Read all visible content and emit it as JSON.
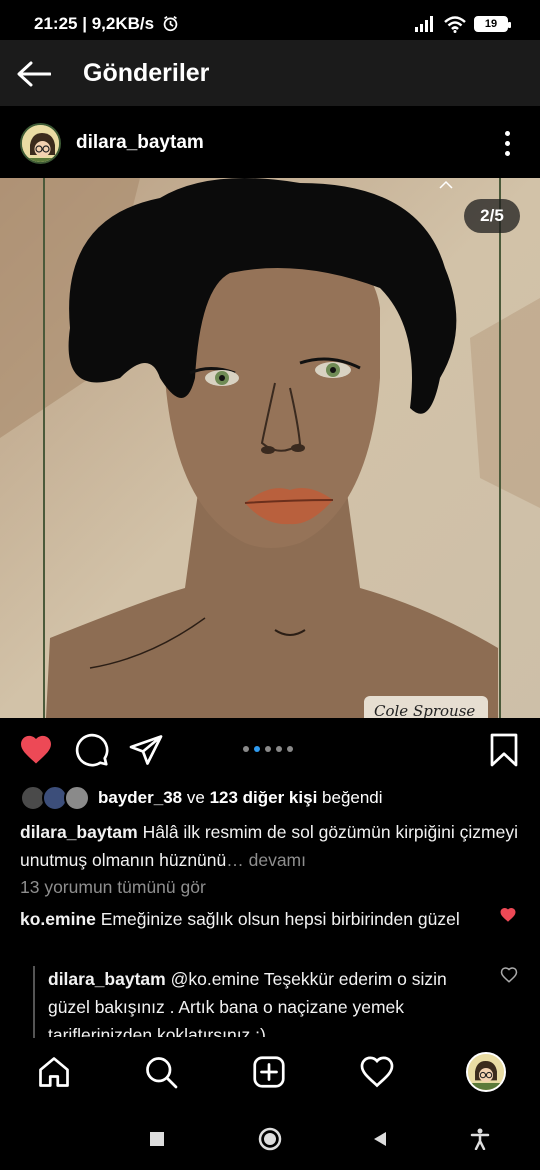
{
  "status": {
    "time": "21:25",
    "speed": "9,2KB/s",
    "battery": "19",
    "icons": [
      "alarm-icon",
      "signal-icon",
      "wifi-icon",
      "battery-icon"
    ]
  },
  "header": {
    "title": "Gönderiler",
    "back_icon": "arrow-left-icon"
  },
  "post": {
    "username": "dilara_baytam",
    "media_counter": "2/5",
    "signature": "Cole Sprouse",
    "carousel_dots": 5,
    "active_dot": 2,
    "liked": true
  },
  "likes": {
    "first_liker": "bayder_38",
    "connector": "ve",
    "others": "123 diğer kişi",
    "suffix": "beğendi"
  },
  "caption": {
    "username": "dilara_baytam",
    "text": "Hâlâ ilk resmim de sol gözümün kirpiğini çizmeyi unutmuş olmanın hüznünü",
    "more": "… devamı"
  },
  "comments_link": "13 yorumun tümünü gör",
  "comments": [
    {
      "username": "ko.emine",
      "text": "Emeğinize sağlık olsun hepsi birbirinden güzel",
      "liked": true
    }
  ],
  "reply": {
    "username": "dilara_baytam",
    "mention": "@ko.emine",
    "text": "Teşekkür ederim o sizin güzel bakışınız . Artık bana o naçizane yemek tariflerinizden koklatırsınız :)",
    "liked": false
  },
  "tabs": [
    "home-icon",
    "search-icon",
    "new-post-icon",
    "activity-icon",
    "profile-avatar"
  ],
  "colors": {
    "like_red": "#ed4956",
    "dot_active": "#2f9bf0",
    "header_bg": "#1b1b1b"
  }
}
